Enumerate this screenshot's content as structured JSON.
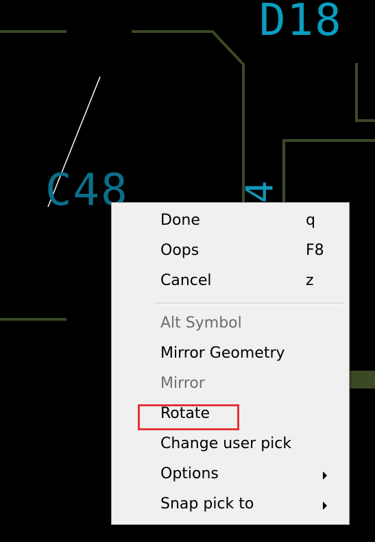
{
  "canvas": {
    "background": "#000000",
    "trace_color": "#3b4a25",
    "labels": {
      "d18": "D18",
      "c48": "C48",
      "pin4": "4"
    }
  },
  "context_menu": {
    "items": [
      {
        "label": "Done",
        "shortcut": "q",
        "enabled": true
      },
      {
        "label": "Oops",
        "shortcut": "F8",
        "enabled": true
      },
      {
        "label": "Cancel",
        "shortcut": "z",
        "enabled": true
      },
      {
        "label": "Alt Symbol",
        "shortcut": "",
        "enabled": false
      },
      {
        "label": "Mirror Geometry",
        "shortcut": "",
        "enabled": true
      },
      {
        "label": "Mirror",
        "shortcut": "",
        "enabled": false
      },
      {
        "label": "Rotate",
        "shortcut": "",
        "enabled": true,
        "highlighted": true
      },
      {
        "label": "Change user pick",
        "shortcut": "",
        "enabled": true
      },
      {
        "label": "Options",
        "shortcut": "",
        "enabled": true,
        "submenu": true
      },
      {
        "label": "Snap pick to",
        "shortcut": "",
        "enabled": true,
        "submenu": true
      }
    ],
    "highlight_color": "#e53338"
  }
}
